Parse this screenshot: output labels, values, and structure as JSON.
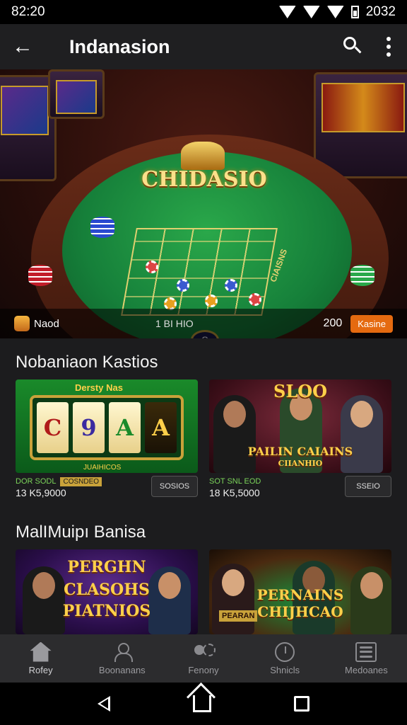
{
  "status_bar": {
    "time": "82:20",
    "right_text": "2032"
  },
  "app_bar": {
    "title": "Indanasion"
  },
  "hero": {
    "logo_text": "CHIDASIO",
    "left_label": "Naod",
    "middle_label": "1 BI HIO",
    "count": "200",
    "button_label": "Kasine",
    "center_chip": "S",
    "felt_text": "CIAISNS"
  },
  "section1": {
    "title": "Nobaniaon Kastios",
    "cards": [
      {
        "banner": "Dersty Nas",
        "reels": [
          "C",
          "9",
          "A",
          "A"
        ],
        "reels_lower": [
          "",
          "",
          "",
          ""
        ],
        "footer": "JUAIHICOS",
        "price": "DOR SODL",
        "tag": "COSNDEO",
        "value": "13 K5,9000",
        "button": "SOSIOS"
      },
      {
        "banner": "SLOO",
        "sub": "PAILIN CAIAINS",
        "sub2": "CIIANHIO",
        "price": "SOT SNL EOD",
        "value": "18 K5,5000",
        "button": "SSEIO"
      }
    ]
  },
  "section2": {
    "title": "MalIMuipı Banisa",
    "cards": [
      {
        "banner": "PERGHN",
        "line2": "CLASOHS",
        "line3": "PIATNIOS"
      },
      {
        "banner": "PERNAINS",
        "line2": "CHIJHCAO",
        "tag": "PEARAN"
      }
    ]
  },
  "bottom_nav": [
    {
      "label": "Rofey",
      "icon": "home-icon",
      "active": true
    },
    {
      "label": "Boonanans",
      "icon": "person-icon",
      "active": false
    },
    {
      "label": "Fenony",
      "icon": "group-icon",
      "active": false
    },
    {
      "label": "Shnicls",
      "icon": "clock-icon",
      "active": false
    },
    {
      "label": "Medoanes",
      "icon": "menu-icon",
      "active": false
    }
  ]
}
